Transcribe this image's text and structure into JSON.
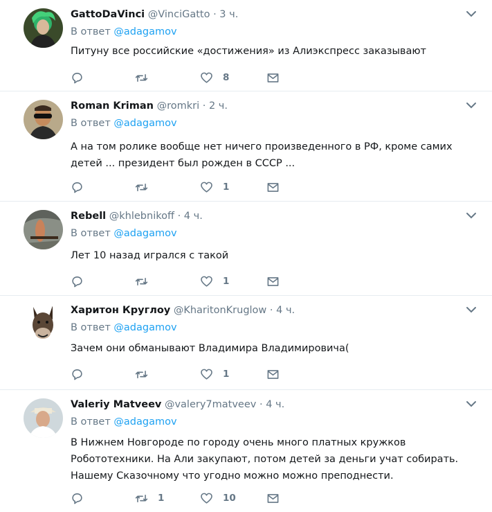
{
  "reply_prefix": "В ответ",
  "icons": {
    "reply": "reply-icon",
    "retweet": "retweet-icon",
    "like": "heart-icon",
    "dm": "envelope-icon",
    "menu": "chevron-down-icon"
  },
  "colors": {
    "text": "#14171a",
    "secondary": "#657786",
    "link": "#1da1f2",
    "divider": "#e6ecf0"
  },
  "tweets": [
    {
      "name": "GattoDaVinci",
      "handle": "@VinciGatto",
      "dot": "·",
      "time": "3 ч.",
      "mention": "@adagamov",
      "text": "Питуну все российские «достижения» из Алиэкспресс заказывают",
      "retweets": "",
      "likes": "8"
    },
    {
      "name": "Roman Kriman",
      "handle": "@romkri",
      "dot": "·",
      "time": "2 ч.",
      "mention": "@adagamov",
      "text": "А на том ролике вообще нет ничего произведенного в РФ, кроме самих\nдетей ... президент был рожден в СССР ...",
      "retweets": "",
      "likes": "1"
    },
    {
      "name": "Rebell",
      "handle": "@khlebnikoff",
      "dot": "·",
      "time": "4 ч.",
      "mention": "@adagamov",
      "text": "Лет 10 назад игрался с такой",
      "retweets": "",
      "likes": "1"
    },
    {
      "name": "Харитон Круглоу",
      "handle": "@KharitonKruglow",
      "dot": "·",
      "time": "4 ч.",
      "mention": "@adagamov",
      "text": "Зачем они обманывают Владимира Владимировича(",
      "retweets": "",
      "likes": "1"
    },
    {
      "name": "Valeriy Matveev",
      "handle": "@valery7matveev",
      "dot": "·",
      "time": "4 ч.",
      "mention": "@adagamov",
      "text": "В Нижнем Новгороде по городу очень много платных кружков\nРобототехники. На Али закупают, потом детей за деньги учат собирать.\nНашему Сказочному что угодно можно можно преподнести.",
      "retweets": "1",
      "likes": "10"
    }
  ]
}
